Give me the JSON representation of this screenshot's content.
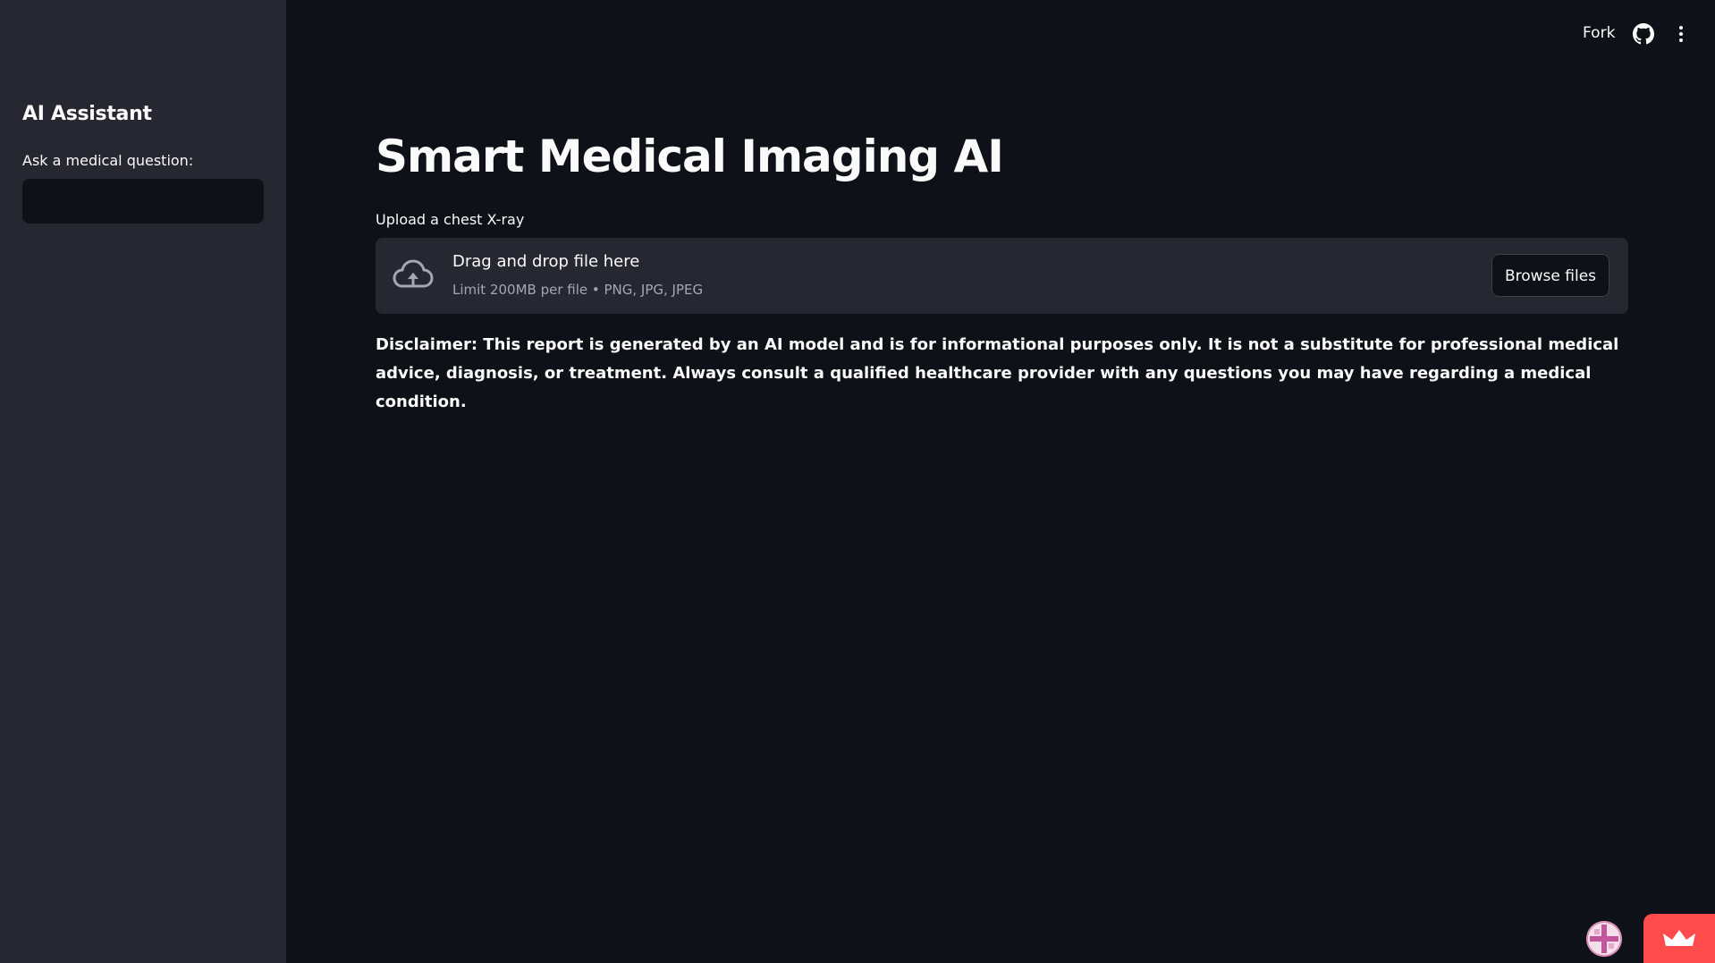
{
  "header": {
    "fork_label": "Fork",
    "github_icon": "github-icon",
    "menu_icon": "kebab-menu-icon"
  },
  "sidebar": {
    "title": "AI Assistant",
    "question_label": "Ask a medical question:",
    "question_value": ""
  },
  "main": {
    "title": "Smart Medical Imaging AI",
    "upload_label": "Upload a chest X-ray",
    "dropzone": {
      "title": "Drag and drop file here",
      "subtitle": "Limit 200MB per file • PNG, JPG, JPEG",
      "browse_label": "Browse files",
      "icon": "cloud-upload-icon"
    },
    "disclaimer": "Disclaimer: This report is generated by an AI model and is for informational purposes only. It is not a substitute for professional medical advice, diagnosis, or treatment. Always consult a qualified healthcare provider with any questions you may have regarding a medical condition."
  },
  "footer": {
    "avatar_icon": "user-avatar-icon",
    "badge_icon": "crown-icon"
  },
  "colors": {
    "background": "#0e1117",
    "sidebar": "#262730",
    "accent": "#ff4b4b",
    "muted_text": "#a3a8b4"
  }
}
